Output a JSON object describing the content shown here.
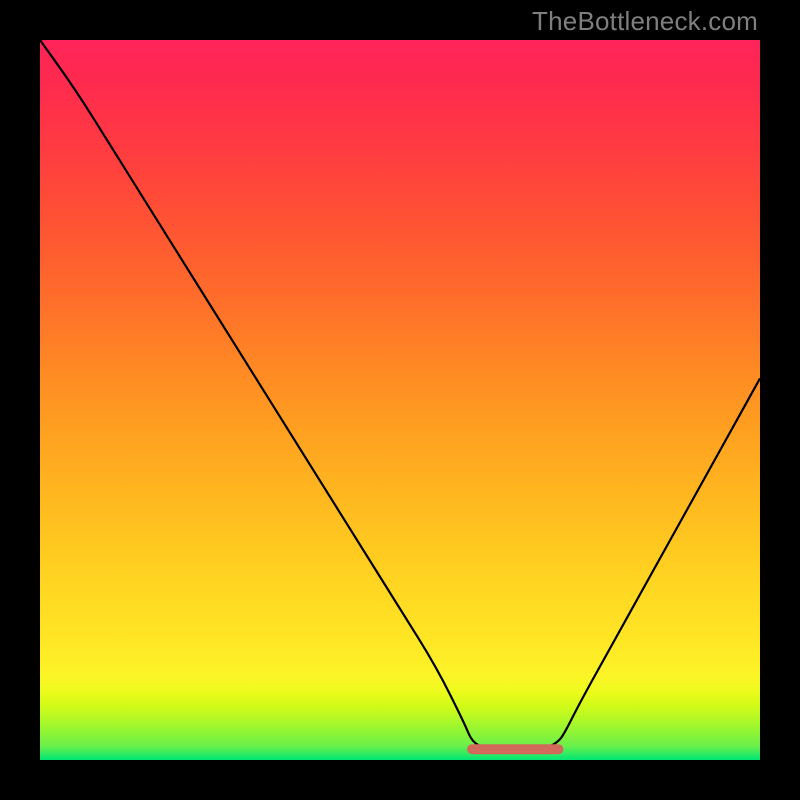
{
  "watermark": "TheBottleneck.com",
  "chart_data": {
    "type": "line",
    "title": "",
    "xlabel": "",
    "ylabel": "",
    "xlim": [
      0,
      100
    ],
    "ylim": [
      0,
      100
    ],
    "grid": false,
    "series": [
      {
        "name": "curve",
        "x": [
          0,
          5,
          10,
          15,
          20,
          25,
          30,
          35,
          40,
          45,
          50,
          55,
          59,
          60,
          62,
          66,
          70,
          72,
          73,
          75,
          80,
          85,
          90,
          95,
          100
        ],
        "values": [
          100,
          93,
          85,
          77,
          69,
          61,
          53,
          45,
          37,
          29,
          21,
          13,
          5,
          2.5,
          1.5,
          1.5,
          1.5,
          2.5,
          4,
          8,
          17,
          26,
          35,
          44,
          53
        ]
      }
    ],
    "annotations": [
      {
        "name": "highlight-segment",
        "type": "segment",
        "color": "#d26a5c",
        "thickness": 10,
        "x_range": [
          60,
          72
        ],
        "y": 1.5
      }
    ],
    "background_gradient": {
      "stops": [
        {
          "y": 0,
          "color": "#00e676"
        },
        {
          "y": 2,
          "color": "#6cf04a"
        },
        {
          "y": 3,
          "color": "#7ff23f"
        },
        {
          "y": 4,
          "color": "#92f534"
        },
        {
          "y": 5,
          "color": "#a4f72b"
        },
        {
          "y": 6,
          "color": "#b7f822"
        },
        {
          "y": 7,
          "color": "#c9fa1b"
        },
        {
          "y": 8,
          "color": "#d8fa18"
        },
        {
          "y": 9,
          "color": "#e6fb1a"
        },
        {
          "y": 10,
          "color": "#f1fa20"
        },
        {
          "y": 12,
          "color": "#fcf327"
        },
        {
          "y": 18,
          "color": "#ffe324"
        },
        {
          "y": 25,
          "color": "#ffd421"
        },
        {
          "y": 35,
          "color": "#ffbb1f"
        },
        {
          "y": 45,
          "color": "#ffa220"
        },
        {
          "y": 55,
          "color": "#ff8724"
        },
        {
          "y": 65,
          "color": "#ff6b2b"
        },
        {
          "y": 75,
          "color": "#ff5234"
        },
        {
          "y": 85,
          "color": "#ff3b41"
        },
        {
          "y": 95,
          "color": "#ff2950"
        },
        {
          "y": 100,
          "color": "#ff245b"
        }
      ]
    }
  }
}
